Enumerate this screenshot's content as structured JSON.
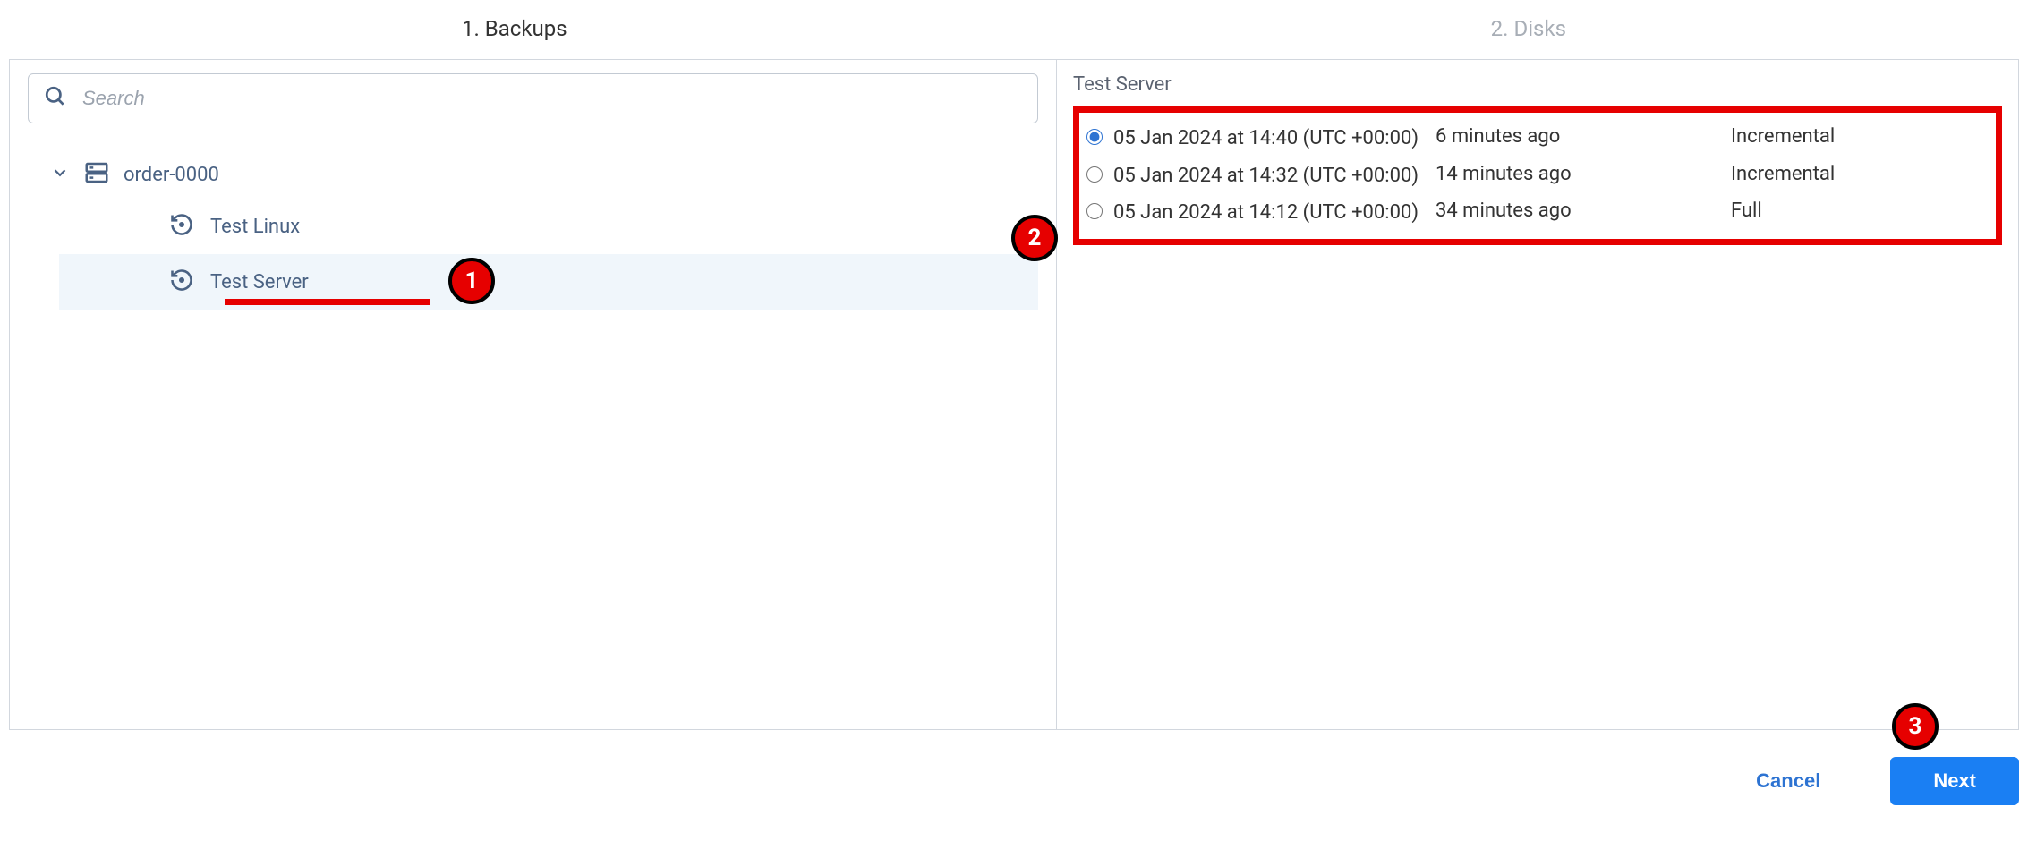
{
  "wizard": {
    "steps": [
      {
        "label": "1. Backups",
        "active": true
      },
      {
        "label": "2. Disks",
        "active": false
      }
    ]
  },
  "search": {
    "placeholder": "Search",
    "value": ""
  },
  "tree": {
    "root": {
      "label": "order-0000",
      "expanded": true,
      "children": [
        {
          "label": "Test Linux",
          "selected": false
        },
        {
          "label": "Test Server",
          "selected": true
        }
      ]
    }
  },
  "details": {
    "title": "Test Server",
    "backups": [
      {
        "datetime": "05 Jan 2024 at 14:40 (UTC +00:00)",
        "relative": "6 minutes ago",
        "type": "Incremental",
        "selected": true
      },
      {
        "datetime": "05 Jan 2024 at 14:32 (UTC +00:00)",
        "relative": "14 minutes ago",
        "type": "Incremental",
        "selected": false
      },
      {
        "datetime": "05 Jan 2024 at 14:12 (UTC +00:00)",
        "relative": "34 minutes ago",
        "type": "Full",
        "selected": false
      }
    ]
  },
  "footer": {
    "cancel": "Cancel",
    "next": "Next"
  },
  "annotations": {
    "b1": "1",
    "b2": "2",
    "b3": "3"
  }
}
